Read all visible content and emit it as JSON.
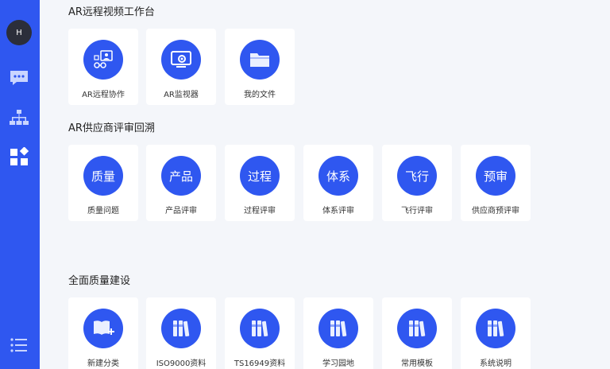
{
  "sidebar": {
    "avatar_letter": "H",
    "icons": [
      "chat-icon",
      "org-chart-icon",
      "apps-grid-icon",
      "menu-list-icon"
    ]
  },
  "sections": [
    {
      "title": "AR远程视频工作台",
      "cards": [
        {
          "label": "AR远程协作",
          "icon": "ar-collab-icon"
        },
        {
          "label": "AR监视器",
          "icon": "monitor-camera-icon"
        },
        {
          "label": "我的文件",
          "icon": "folder-icon"
        }
      ]
    },
    {
      "title": "AR供应商评审回溯",
      "cards": [
        {
          "label": "质量问题",
          "badge": "质量"
        },
        {
          "label": "产品评审",
          "badge": "产品"
        },
        {
          "label": "过程评审",
          "badge": "过程"
        },
        {
          "label": "体系评审",
          "badge": "体系"
        },
        {
          "label": "飞行评审",
          "badge": "飞行"
        },
        {
          "label": "供应商预评审",
          "badge": "预审"
        }
      ]
    },
    {
      "title": "全面质量建设",
      "cards": [
        {
          "label": "新建分类",
          "icon": "book-add-icon"
        },
        {
          "label": "ISO9000资料",
          "icon": "binders-icon"
        },
        {
          "label": "TS16949资料",
          "icon": "binders-icon"
        },
        {
          "label": "学习园地",
          "icon": "binders-icon"
        },
        {
          "label": "常用模板",
          "icon": "binders-icon"
        },
        {
          "label": "系统说明",
          "icon": "binders-icon"
        }
      ]
    }
  ],
  "colors": {
    "accent": "#2f57f0",
    "background": "#f4f6fa",
    "card": "#ffffff"
  }
}
